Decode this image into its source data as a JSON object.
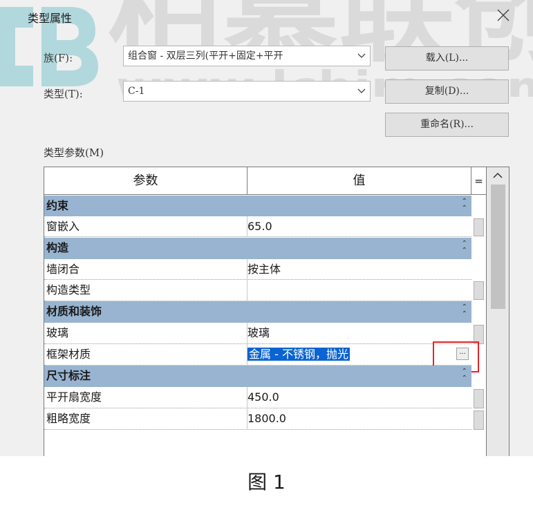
{
  "dialog": {
    "title": "类型属性",
    "family_label": "族(F):",
    "family_value": "组合窗 - 双层三列(平开+固定+平开",
    "type_label": "类型(T):",
    "type_value": "C-1",
    "load_button": "载入(L)...",
    "duplicate_button": "复制(D)...",
    "rename_button": "重命名(R)...",
    "type_params_label": "类型参数(M)"
  },
  "watermark": {
    "brand_text": "柏慕联创",
    "url_text": "www.lcbim.com"
  },
  "table": {
    "headers": {
      "param": "参数",
      "value": "值",
      "eq": "="
    },
    "groups": [
      {
        "name": "约束",
        "rows": [
          {
            "param": "窗嵌入",
            "value": "65.0"
          }
        ]
      },
      {
        "name": "构造",
        "rows": [
          {
            "param": "墙闭合",
            "value": "按主体"
          },
          {
            "param": "构造类型",
            "value": ""
          }
        ]
      },
      {
        "name": "材质和装饰",
        "rows": [
          {
            "param": "玻璃",
            "value": "玻璃"
          },
          {
            "param": "框架材质",
            "value": "金属 - 不锈钢，抛光",
            "selected": true
          }
        ]
      },
      {
        "name": "尺寸标注",
        "rows": [
          {
            "param": "平开扇宽度",
            "value": "450.0"
          },
          {
            "param": "粗略宽度",
            "value": "1800.0"
          }
        ]
      }
    ],
    "edit_button_label": "..."
  },
  "caption": "图 1",
  "colors": {
    "group_header_bg": "#98b4d0",
    "selection_bg": "#0a64d2",
    "highlight_box": "#e52222",
    "watermark": "#5ab8c4"
  },
  "icons": {
    "close": "close-icon",
    "dropdown": "chevron-down-icon",
    "collapse": "double-chevron-up-icon",
    "scroll_up": "chevron-up-icon"
  }
}
